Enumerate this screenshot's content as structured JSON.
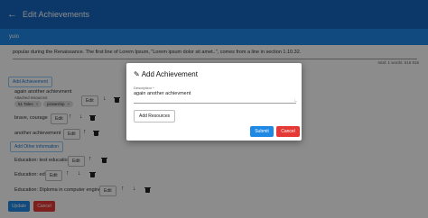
{
  "header": {
    "back_icon": "arrow-left-icon",
    "title": "Edit Achievements"
  },
  "strip": {
    "text": "yuio"
  },
  "description": {
    "text": "popular during the Renaissance. The first line of Lorem Ipsum, \"Lorem ipsum dolor sit amet..\", comes from a line in section 1.10.32.",
    "counter": "total: 1   words: 616   816"
  },
  "achievements": {
    "add_label": "Add Achievement",
    "items": [
      {
        "label": "again another achievment",
        "sub": "Attached resources:",
        "chips": [
          "51 Tales",
          "pirateship"
        ],
        "edit": "Edit"
      },
      {
        "label": "brave, courage",
        "edit": "Edit"
      },
      {
        "label": "another achievement",
        "edit": "Edit"
      }
    ]
  },
  "other": {
    "add_label": "Add Other information",
    "items": [
      {
        "label": "Education: test education 2",
        "edit": "Edit"
      },
      {
        "label": "Education: edu",
        "edit": "Edit"
      },
      {
        "label": "Education: Diploma in computer engineering",
        "edit": "Edit"
      }
    ]
  },
  "footer": {
    "update": "Update",
    "cancel": "Cancel"
  },
  "modal": {
    "title": "Add Achievement",
    "field_label": "Description *",
    "field_value": "again another achievment",
    "add_resources": "Add Resources",
    "submit": "Submit",
    "cancel": "Cancel"
  },
  "colors": {
    "primary": "#1e88e5",
    "danger": "#e53935",
    "appbar": "#1565c0"
  }
}
